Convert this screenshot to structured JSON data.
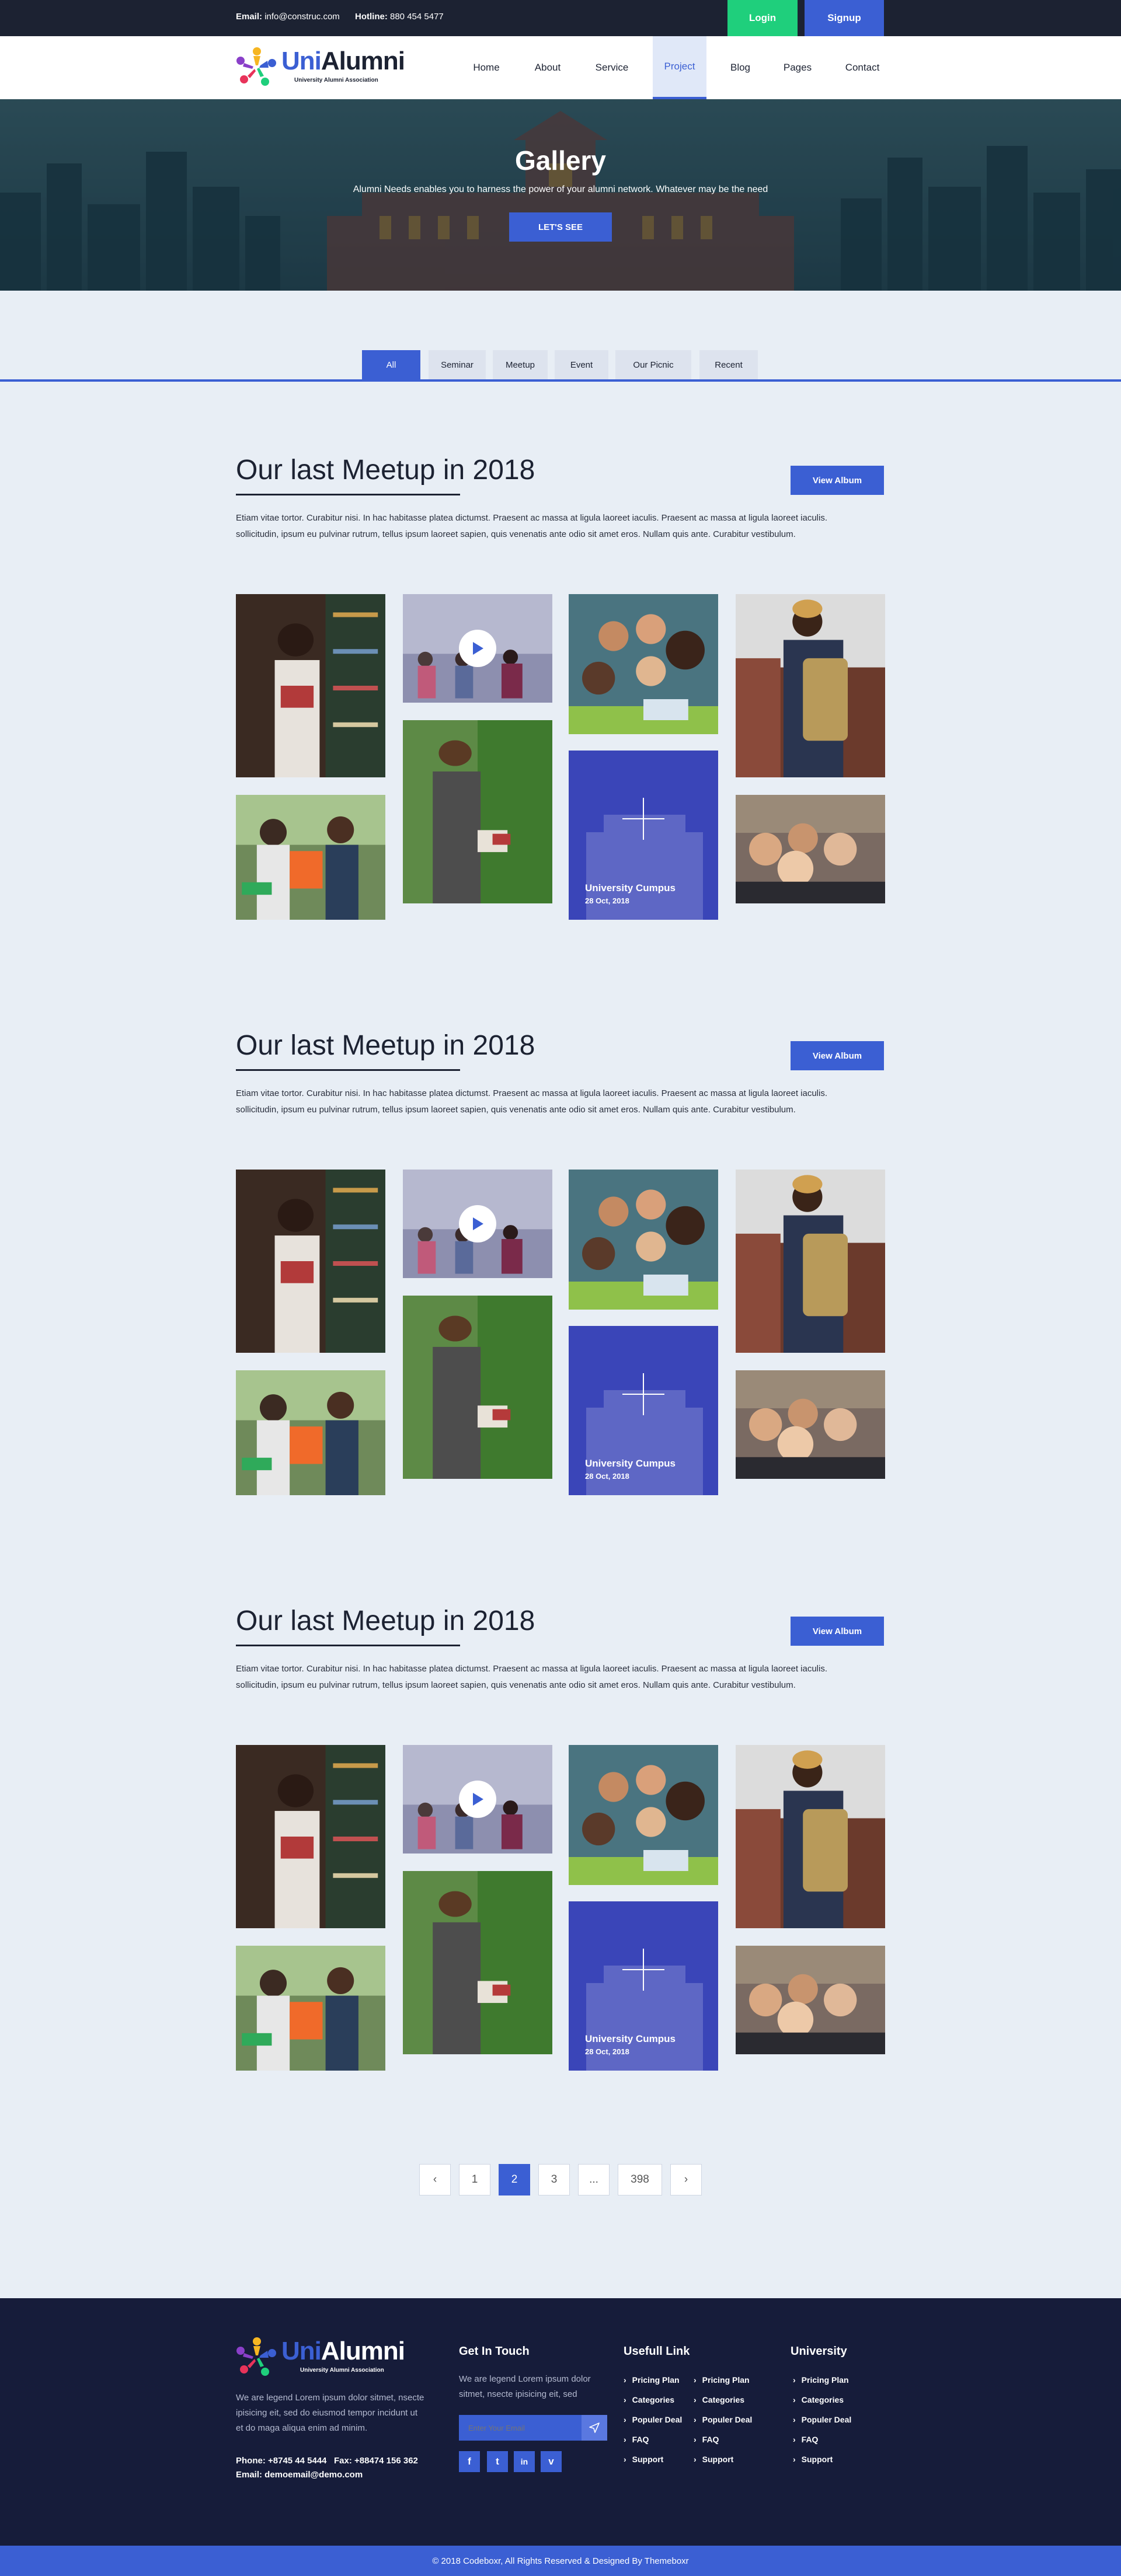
{
  "topbar": {
    "email_label": "Email:",
    "email_value": "info@construc.com",
    "hotline_label": "Hotline:",
    "hotline_value": "880 454 5477",
    "login": "Login",
    "signup": "Signup"
  },
  "brand": {
    "name_part1": "Uni",
    "name_part2": "Alumni",
    "tagline": "University Alumni Association"
  },
  "nav": {
    "items": [
      "Home",
      "About",
      "Service",
      "Project",
      "Blog",
      "Pages",
      "Contact"
    ],
    "active": "Project"
  },
  "hero": {
    "title": "Gallery",
    "subtitle": "Alumni Needs enables you to harness the power of your alumni network. Whatever may be the need",
    "button": "LET'S SEE"
  },
  "tabs": [
    "All",
    "Seminar",
    "Meetup",
    "Event",
    "Our Picnic",
    "Recent"
  ],
  "sections": [
    {
      "title": "Our last Meetup in 2018",
      "button": "View Album",
      "text_line1": "Etiam vitae tortor. Curabitur nisi. In hac habitasse platea dictumst. Praesent ac massa at ligula laoreet iaculis. Praesent ac massa at ligula laoreet iaculis.",
      "text_line2": "sollicitudin, ipsum eu pulvinar rutrum, tellus ipsum laoreet sapien, quis venenatis ante odio sit amet eros. Nullam quis ante. Curabitur vestibulum.",
      "album_name": "University Cumpus",
      "album_date": "28 Oct, 2018"
    },
    {
      "title": "Our last Meetup in 2018",
      "button": "View Album",
      "text_line1": "Etiam vitae tortor. Curabitur nisi. In hac habitasse platea dictumst. Praesent ac massa at ligula laoreet iaculis. Praesent ac massa at ligula laoreet iaculis.",
      "text_line2": "sollicitudin, ipsum eu pulvinar rutrum, tellus ipsum laoreet sapien, quis venenatis ante odio sit amet eros. Nullam quis ante. Curabitur vestibulum.",
      "album_name": "University Cumpus",
      "album_date": "28 Oct, 2018"
    },
    {
      "title": "Our last Meetup in 2018",
      "button": "View Album",
      "text_line1": "Etiam vitae tortor. Curabitur nisi. In hac habitasse platea dictumst. Praesent ac massa at ligula laoreet iaculis. Praesent ac massa at ligula laoreet iaculis.",
      "text_line2": "sollicitudin, ipsum eu pulvinar rutrum, tellus ipsum laoreet sapien, quis venenatis ante odio sit amet eros. Nullam quis ante. Curabitur vestibulum.",
      "album_name": "University Cumpus",
      "album_date": "28 Oct, 2018"
    }
  ],
  "pagination": {
    "prev": "‹",
    "pages": [
      "1",
      "2",
      "3",
      "...",
      "398"
    ],
    "active": "2",
    "next": "›"
  },
  "footer": {
    "about_line1": "We are legend Lorem ipsum dolor sitmet, nsecte",
    "about_line2": "ipisicing eit, sed do eiusmod tempor incidunt ut",
    "about_line3": "et do maga aliqua enim ad minim.",
    "phone": "Phone: +8745 44 5444   Fax: +88474 156 362",
    "email": "Email: demoemail@demo.com",
    "touch_title": "Get In Touch",
    "touch_line1": "We are legend Lorem ipsum dolor",
    "touch_line2": "sitmet, nsecte ipisicing eit, sed",
    "email_placeholder": "Enter Your Email",
    "social": [
      "f",
      "t",
      "in",
      "v"
    ],
    "useful_title": "Usefull Link",
    "useful_col1": [
      "Pricing Plan",
      "Categories",
      "Populer Deal",
      "FAQ",
      "Support"
    ],
    "useful_col2": [
      "Pricing Plan",
      "Categories",
      "Populer Deal",
      "FAQ",
      "Support"
    ],
    "university_title": "University",
    "university_links": [
      "Pricing Plan",
      "Categories",
      "Populer Deal",
      "FAQ",
      "Support"
    ],
    "copyright": "© 2018 Codeboxr, All Rights Reserved & Designed By Themeboxr"
  },
  "colors": {
    "accent": "#3b5fd3",
    "login_green": "#1fcf7c",
    "dark": "#1c2232",
    "footer_bg": "#161c3a",
    "page_bg": "#e8eef5",
    "album_tile": "#3a45b8"
  }
}
